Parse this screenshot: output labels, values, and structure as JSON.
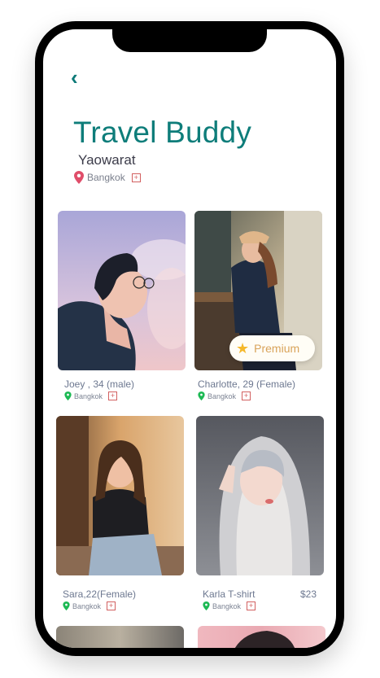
{
  "header": {
    "title": "Travel Buddy",
    "subtitle": "Yaowarat",
    "location": "Bangkok",
    "back_icon": "chevron-left-icon"
  },
  "colors": {
    "accent": "#0e7d7a",
    "location_pin": "#e04e6a",
    "buddy_pin": "#1db954",
    "premium_text": "#d9a35a"
  },
  "buddies": [
    {
      "name": "Joey , 34 (male)",
      "location": "Bangkok"
    },
    {
      "name": "Charlotte, 29 (Female)",
      "location": "Bangkok",
      "badge": "Premium"
    },
    {
      "name": "Sara,22(Female)",
      "location": "Bangkok"
    },
    {
      "name": "Karla T-shirt",
      "location": "Bangkok",
      "price": "$23"
    }
  ]
}
